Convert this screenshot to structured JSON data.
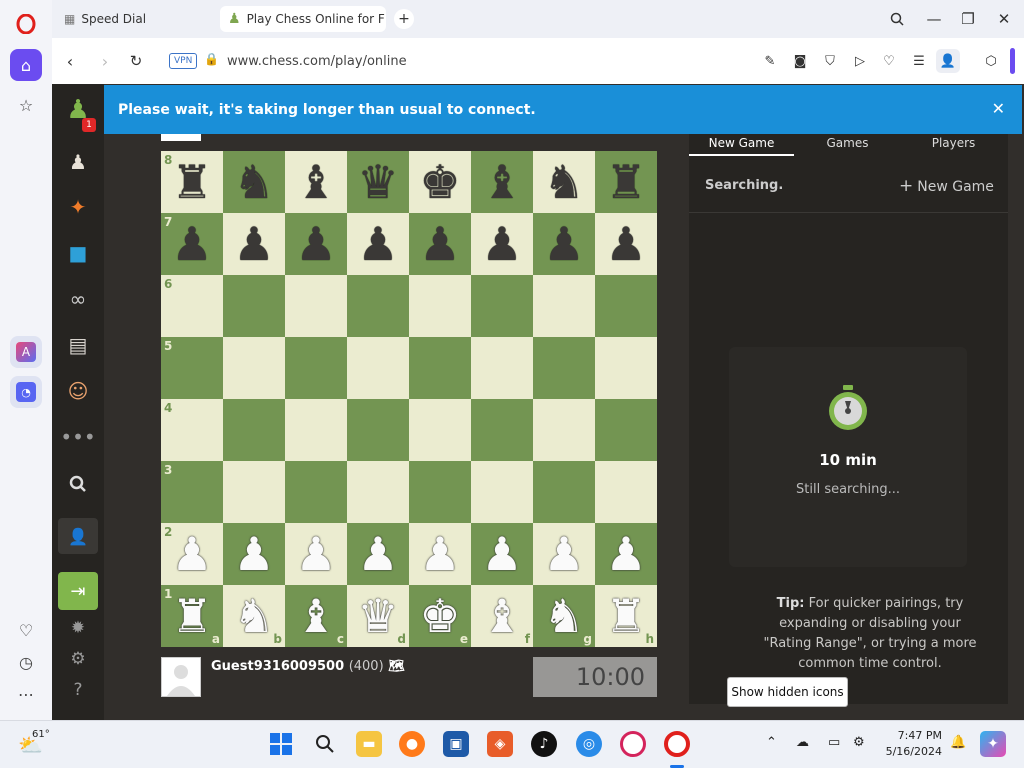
{
  "browser": {
    "tabs": [
      {
        "label": "Speed Dial",
        "icon": "grid-icon"
      },
      {
        "label": "Play Chess Online for FREE",
        "icon": "pawn-icon"
      }
    ],
    "new_tab_symbol": "+",
    "vpn_badge": "VPN",
    "url": "www.chess.com/play/online"
  },
  "chess_site": {
    "notification_badge": "1",
    "banner": "Please wait, it's taking longer than usual to connect.",
    "board": {
      "ranks": [
        "8",
        "7",
        "6",
        "5",
        "4",
        "3",
        "2",
        "1"
      ],
      "files": [
        "a",
        "b",
        "c",
        "d",
        "e",
        "f",
        "g",
        "h"
      ],
      "rows": [
        [
          "♜",
          "♞",
          "♝",
          "♛",
          "♚",
          "♝",
          "♞",
          "♜"
        ],
        [
          "♟",
          "♟",
          "♟",
          "♟",
          "♟",
          "♟",
          "♟",
          "♟"
        ],
        [
          "",
          "",
          "",
          "",
          "",
          "",
          "",
          ""
        ],
        [
          "",
          "",
          "",
          "",
          "",
          "",
          "",
          ""
        ],
        [
          "",
          "",
          "",
          "",
          "",
          "",
          "",
          ""
        ],
        [
          "",
          "",
          "",
          "",
          "",
          "",
          "",
          ""
        ],
        [
          "♟",
          "♟",
          "♟",
          "♟",
          "♟",
          "♟",
          "♟",
          "♟"
        ],
        [
          "♜",
          "♞",
          "♝",
          "♛",
          "♚",
          "♝",
          "♞",
          "♜"
        ]
      ],
      "light_color": "#ebecd0",
      "dark_color": "#739552"
    },
    "player": {
      "name": "Guest9316009500",
      "rating": "(400)",
      "flag": "🗺"
    },
    "clock": "10:00",
    "panel": {
      "tabs": [
        "New Game",
        "Games",
        "Players"
      ],
      "status": "Searching.",
      "new_game_button": "New Game",
      "time_control": "10 min",
      "search_status": "Still searching...",
      "tip_label": "Tip:",
      "tip_text": "For quicker pairings, try expanding or disabling your \"Rating Range\", or trying a more common time control."
    }
  },
  "tooltip": "Show hidden icons",
  "taskbar": {
    "weather": "61°",
    "time": "7:47 PM",
    "date": "5/16/2024"
  }
}
